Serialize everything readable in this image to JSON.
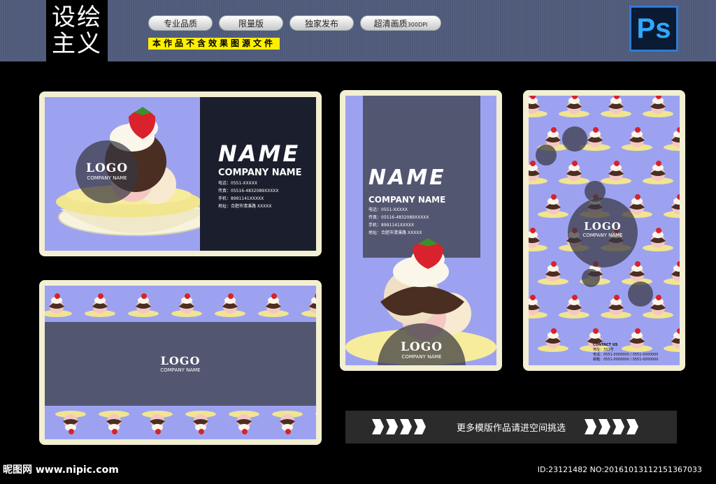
{
  "header": {
    "brand_line1": "设绘",
    "brand_line2": "主义",
    "badges": [
      "专业品质",
      "限量版",
      "独家发布",
      "超清画质"
    ],
    "badge_suffix": "300DPI",
    "notice": "本作品不含效果图源文件",
    "ps_label": "Ps"
  },
  "card1": {
    "logo": "LOGO",
    "logo_sub": "COMPANY NAME",
    "name": "NAME",
    "company": "COMPANY NAME",
    "details": [
      "电话：0551-XXXXX",
      "传真：05516-4832089XXXXX",
      "手机：8991141XXXXX",
      "地址：合肥市清溪路 XXXXX"
    ]
  },
  "card2": {
    "name": "NAME",
    "company": "COMPANY NAME",
    "details": [
      "电话：0551-XXXXX",
      "传真：05516-4832089XXXXX",
      "手机：8991141XXXXX",
      "地址：合肥市清溪路 XXXXX"
    ],
    "logo": "LOGO",
    "logo_sub": "COMPANY NAME"
  },
  "card3": {
    "logo": "LOGO",
    "logo_sub": "COMPANY NAME",
    "contact_title": "CONTACT US",
    "contact_lines": [
      "地址：333号",
      "电话：0551-0000000 / 0551-0000000",
      "邮箱：0551-0000000 / 0551-0000000"
    ]
  },
  "card4": {
    "logo": "LOGO",
    "logo_sub": "COMPANY NAME"
  },
  "footer": {
    "more_text": "更多模版作品请进空间挑选",
    "watermark": "昵图网 www.nipic.com",
    "id_text": "ID:23121482 NO:20161013112151367033"
  },
  "colors": {
    "card_frame": "#f3efd2",
    "card_bg": "#9da2f0",
    "panel_dark": "#1b1e2c",
    "panel_slate": "#525670"
  }
}
